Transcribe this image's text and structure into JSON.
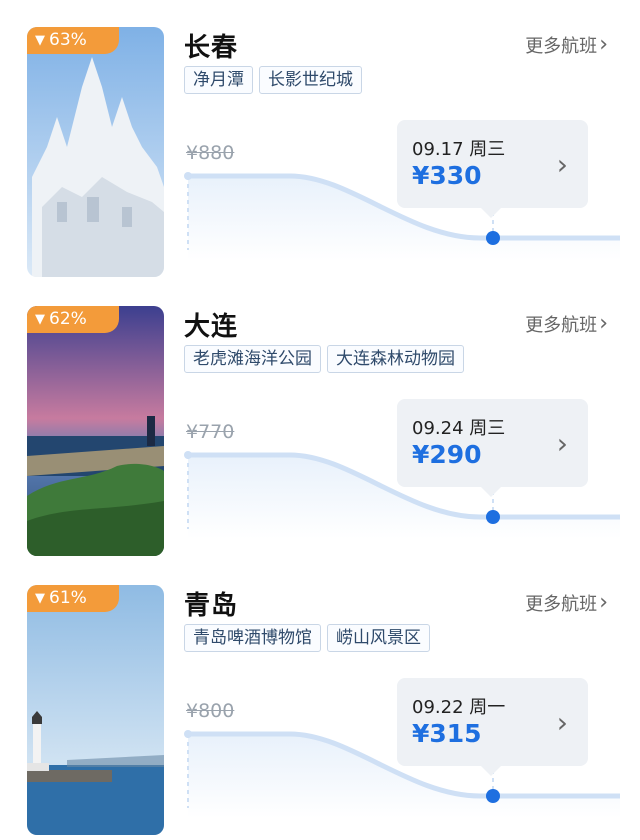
{
  "colors": {
    "price": "#1e6fe0",
    "badge": "#f39b3a",
    "curve": "#cfe0f5",
    "dot": "#1e6fe0"
  },
  "icons": {
    "badge_icon": "down-arrow-icon",
    "chevron": "chevron-right-icon"
  },
  "destinations": [
    {
      "badge": "63%",
      "city": "长春",
      "more": "更多航班",
      "tags": [
        "净月潭",
        "长影世纪城"
      ],
      "original_price": "¥880",
      "date": "09.17 周三",
      "price": "¥330"
    },
    {
      "badge": "62%",
      "city": "大连",
      "more": "更多航班",
      "tags": [
        "老虎滩海洋公园",
        "大连森林动物园"
      ],
      "original_price": "¥770",
      "date": "09.24 周三",
      "price": "¥290"
    },
    {
      "badge": "61%",
      "city": "青岛",
      "more": "更多航班",
      "tags": [
        "青岛啤酒博物馆",
        "崂山风景区"
      ],
      "original_price": "¥800",
      "date": "09.22 周一",
      "price": "¥315"
    }
  ]
}
